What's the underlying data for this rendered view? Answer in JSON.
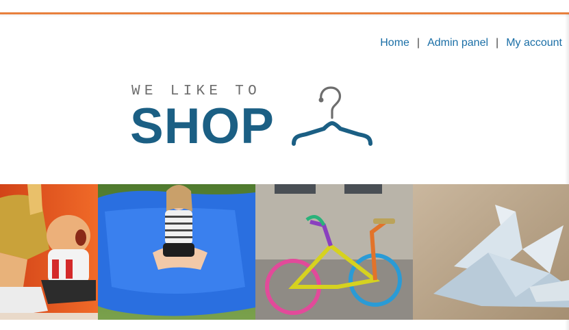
{
  "nav": {
    "items": [
      {
        "label": "Home"
      },
      {
        "label": "Admin panel"
      },
      {
        "label": "My account"
      }
    ],
    "separator": "|"
  },
  "logo": {
    "tagline": "WE LIKE TO",
    "word": "SHOP",
    "icon": "hanger-icon"
  },
  "banner": {
    "photos": [
      {
        "name": "cartoon-figures-photo"
      },
      {
        "name": "girl-on-beanbag-photo"
      },
      {
        "name": "knitted-bicycle-photo"
      },
      {
        "name": "origami-banknote-photo"
      }
    ]
  },
  "colors": {
    "accent": "#e8803d",
    "link": "#1a6ea6",
    "brand": "#1b5f84"
  }
}
